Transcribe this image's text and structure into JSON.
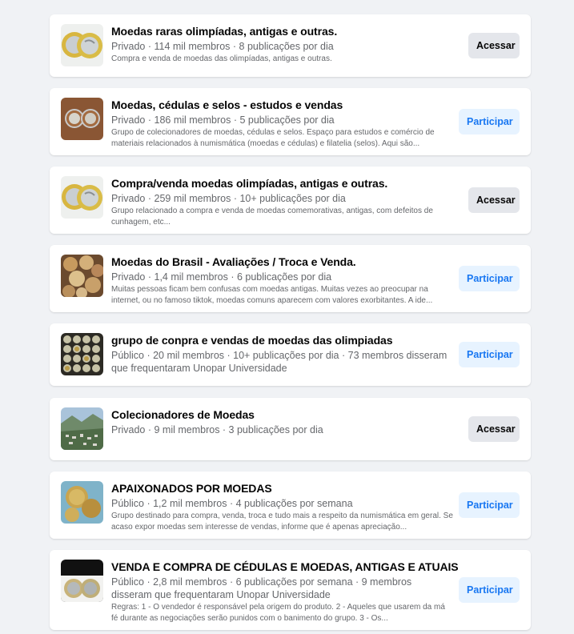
{
  "groups": [
    {
      "name": "Moedas raras olimpíadas, antigas e outras.",
      "meta": "Privado · 114 mil membros · 8 publicações por dia",
      "description": "Compra e venda de moedas das olimpíadas, antigas e outras.",
      "action": "Acessar",
      "thumbnail": "olympic-coins-image"
    },
    {
      "name": "Moedas, cédulas e selos - estudos e vendas",
      "meta": "Privado · 186 mil membros · 5 publicações por dia",
      "description": "Grupo de colecionadores de moedas, cédulas e selos. Espaço para estudos e comércio de materiais relacionados à numismática (moedas e cédulas) e filatelia (selos). Aqui são...",
      "action": "Participar",
      "thumbnail": "coins-in-cases-image"
    },
    {
      "name": "Compra/venda moedas olimpíadas, antigas e outras.",
      "meta": "Privado · 259 mil membros · 10+ publicações por dia",
      "description": "Grupo relacionado a compra e venda de moedas comemorativas, antigas, com defeitos de cunhagem, etc...",
      "action": "Acessar",
      "thumbnail": "olympic-coins-image"
    },
    {
      "name": "Moedas do Brasil - Avaliações / Troca e Venda.",
      "meta": "Privado · 1,4 mil membros · 6 publicações por dia",
      "description": "Muitas pessoas ficam bem confusas com moedas antigas. Muitas vezes ao preocupar na internet, ou no famoso tiktok, moedas comuns aparecem com valores exorbitantes. A ide...",
      "action": "Participar",
      "thumbnail": "coin-pile-image"
    },
    {
      "name": "grupo de conpra e vendas de moedas das olimpiadas",
      "meta": "Público · 20 mil membros · 10+ publicações por dia · 73 membros disseram que frequentaram Unopar Universidade",
      "description": "",
      "action": "Participar",
      "thumbnail": "coin-collection-grid-image"
    },
    {
      "name": "Colecionadores de Moedas",
      "meta": "Privado · 9 mil membros · 3 publicações por dia",
      "description": "",
      "action": "Acessar",
      "thumbnail": "city-landscape-image"
    },
    {
      "name": "APAIXONADOS POR MOEDAS",
      "meta": "Público · 1,2 mil membros · 4 publicações por semana",
      "description": "Grupo destinado para compra, venda, troca e tudo mais a respeito da numismática em geral. Se acaso expor moedas sem interesse de vendas, informe que é apenas apreciação...",
      "action": "Participar",
      "thumbnail": "gold-coins-image"
    },
    {
      "name": "VENDA E COMPRA DE CÉDULAS E MOEDAS, ANTIGAS E ATUAIS",
      "meta": "Público · 2,8 mil membros · 6 publicações por semana · 9 membros disseram que frequentaram Unopar Universidade",
      "description": "Regras: 1 - O vendedor é responsável pela origem do produto. 2 - Aqueles que usarem da má fé durante as negociações serão punidos com o banimento do grupo. 3 - Os...",
      "action": "Participar",
      "thumbnail": "two-coins-dark-image"
    }
  ]
}
